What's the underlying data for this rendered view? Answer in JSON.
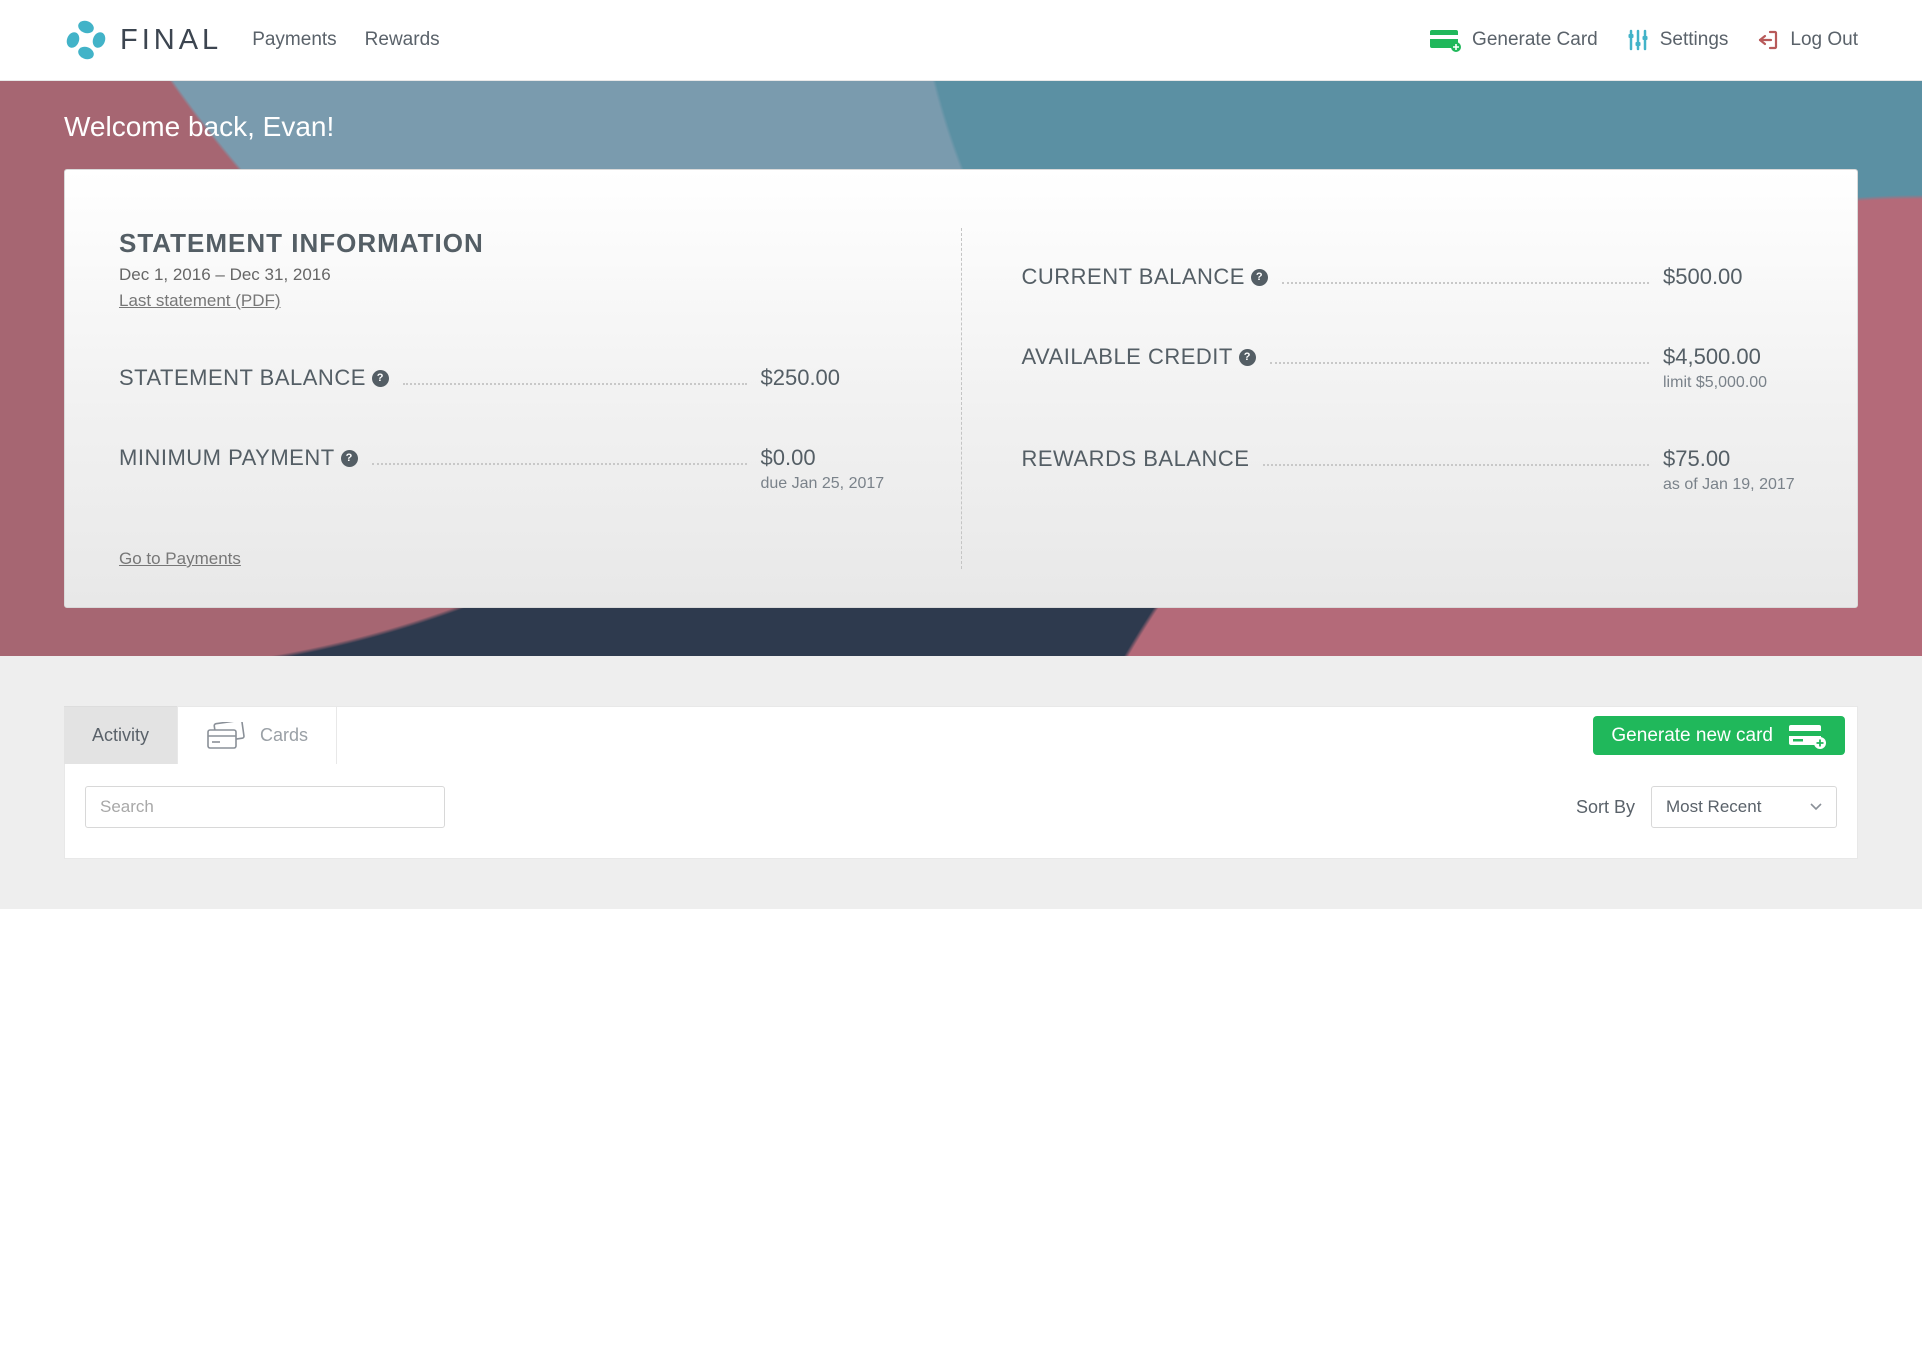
{
  "brand": {
    "name": "FINAL"
  },
  "nav": {
    "left": [
      {
        "label": "Payments"
      },
      {
        "label": "Rewards"
      }
    ],
    "right": {
      "generate": "Generate Card",
      "settings": "Settings",
      "logout": "Log Out"
    }
  },
  "hero": {
    "welcome": "Welcome back, Evan!"
  },
  "statement": {
    "title": "STATEMENT INFORMATION",
    "date_range": "Dec 1, 2016 – Dec 31, 2016",
    "pdf_link": "Last statement (PDF)",
    "rows": {
      "statement_balance": {
        "label": "STATEMENT BALANCE",
        "value": "$250.00"
      },
      "minimum_payment": {
        "label": "MINIMUM PAYMENT",
        "value": "$0.00",
        "sub": "due Jan 25, 2017"
      },
      "current_balance": {
        "label": "CURRENT BALANCE",
        "value": "$500.00"
      },
      "available_credit": {
        "label": "AVAILABLE CREDIT",
        "value": "$4,500.00",
        "sub": "limit $5,000.00"
      },
      "rewards_balance": {
        "label": "REWARDS BALANCE",
        "value": "$75.00",
        "sub": "as of Jan 19, 2017"
      }
    },
    "go_to_payments": "Go to Payments"
  },
  "tabs": {
    "activity": "Activity",
    "cards": "Cards"
  },
  "generate_button": "Generate new card",
  "filters": {
    "search_placeholder": "Search",
    "sort_label": "Sort By",
    "sort_value": "Most Recent"
  },
  "colors": {
    "accent_green": "#20b85b",
    "brand_teal": "#42b3c8"
  }
}
